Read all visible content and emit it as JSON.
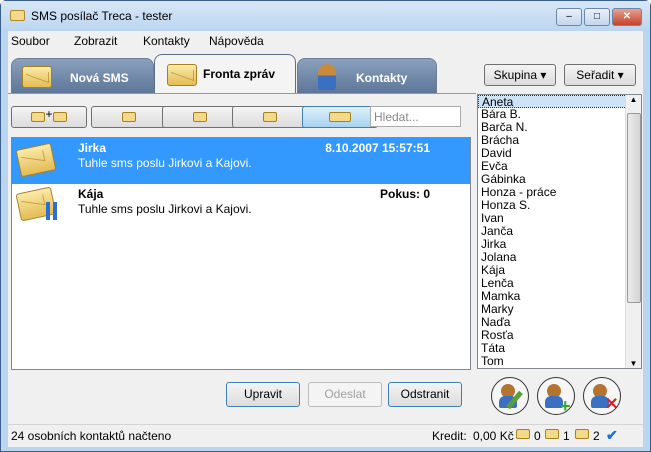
{
  "window": {
    "title": "SMS posílač Treca - tester",
    "min": "–",
    "max": "□",
    "close": "✕"
  },
  "menu": [
    "Soubor",
    "Zobrazit",
    "Kontakty",
    "Nápověda"
  ],
  "tabs": [
    "Nová SMS",
    "Fronta zpráv",
    "Kontakty"
  ],
  "toolbar": {
    "search_placeholder": "Hledat...",
    "plus": "+"
  },
  "messages": [
    {
      "name": "Jirka",
      "text": "Tuhle sms poslu Jirkovi a Kajovi.",
      "right": "8.10.2007 15:57:51",
      "selected": true
    },
    {
      "name": "Kája",
      "text": "Tuhle sms poslu Jirkovi a Kajovi.",
      "right": "Pokus: 0",
      "selected": false
    }
  ],
  "buttons": {
    "edit": "Upravit",
    "send": "Odeslat",
    "delete": "Odstranit"
  },
  "contacts": {
    "group": "Skupina",
    "sort": "Seřadit",
    "items": [
      "Aneta",
      "Bára B.",
      "Barča N.",
      "Brácha",
      "David",
      "Evča",
      "Gábinka",
      "Honza - práce",
      "Honza S.",
      "Ivan",
      "Janča",
      "Jirka",
      "Jolana",
      "Kája",
      "Lenča",
      "Mamka",
      "Marky",
      "Naďa",
      "Rosťa",
      "Táta",
      "Tom"
    ]
  },
  "status": {
    "text": "24 osobních kontaktů načteno",
    "credit_label": "Kredit:",
    "credit": "0,00 Kč",
    "sending": "0",
    "paused": "1",
    "queued": "2"
  }
}
